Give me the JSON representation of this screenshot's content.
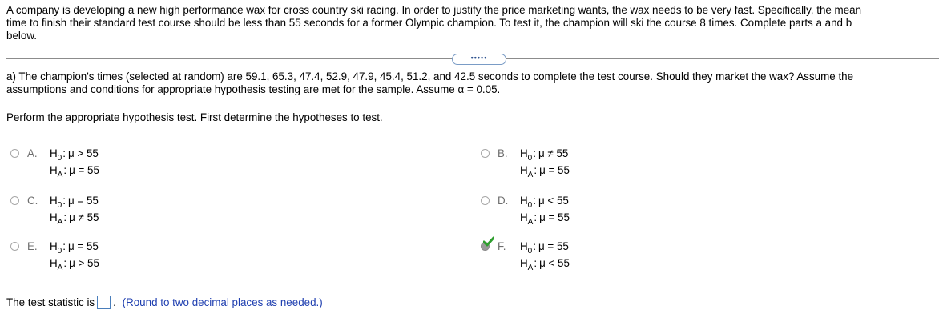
{
  "intro": {
    "line1": "A company is developing a new high performance wax for cross country ski racing. In order to justify the price marketing wants, the wax needs to be very fast. Specifically, the mean",
    "line2": "time to finish their standard test course should be less than 55 seconds for a former Olympic champion. To test it, the champion will ski the course 8 times. Complete parts a and b",
    "line3": "below."
  },
  "expander_label": "•••••",
  "part_a": {
    "line1": "a) The champion's times (selected at random) are 59.1, 65.3, 47.4, 52.9, 47.9, 45.4, 51.2, and 42.5 seconds to complete the test course. Should they market the wax? Assume the",
    "line2": "assumptions and conditions for appropriate hypothesis testing are met for the sample. Assume α = 0.05."
  },
  "instruction": "Perform the appropriate hypothesis test. First determine the hypotheses to test.",
  "options": [
    {
      "letter": "A.",
      "h0_lbl": "H",
      "h0_sub": "0",
      "h0_expr": "μ > 55",
      "ha_lbl": "H",
      "ha_sub": "A",
      "ha_expr": "μ = 55",
      "selected": false
    },
    {
      "letter": "B.",
      "h0_lbl": "H",
      "h0_sub": "0",
      "h0_expr": "μ ≠ 55",
      "ha_lbl": "H",
      "ha_sub": "A",
      "ha_expr": "μ = 55",
      "selected": false
    },
    {
      "letter": "C.",
      "h0_lbl": "H",
      "h0_sub": "0",
      "h0_expr": "μ = 55",
      "ha_lbl": "H",
      "ha_sub": "A",
      "ha_expr": "μ ≠ 55",
      "selected": false
    },
    {
      "letter": "D.",
      "h0_lbl": "H",
      "h0_sub": "0",
      "h0_expr": "μ < 55",
      "ha_lbl": "H",
      "ha_sub": "A",
      "ha_expr": "μ = 55",
      "selected": false
    },
    {
      "letter": "E.",
      "h0_lbl": "H",
      "h0_sub": "0",
      "h0_expr": "μ = 55",
      "ha_lbl": "H",
      "ha_sub": "A",
      "ha_expr": "μ > 55",
      "selected": false
    },
    {
      "letter": "F.",
      "h0_lbl": "H",
      "h0_sub": "0",
      "h0_expr": "μ = 55",
      "ha_lbl": "H",
      "ha_sub": "A",
      "ha_expr": "μ < 55",
      "selected": true
    }
  ],
  "test_statistic": {
    "label": "The test statistic is",
    "value": "",
    "after": ".",
    "hint": "(Round to two decimal places as needed.)"
  },
  "colors": {
    "check": "#2e9e2e",
    "link": "#1f3fb0",
    "box_border": "#4a7ebb"
  }
}
